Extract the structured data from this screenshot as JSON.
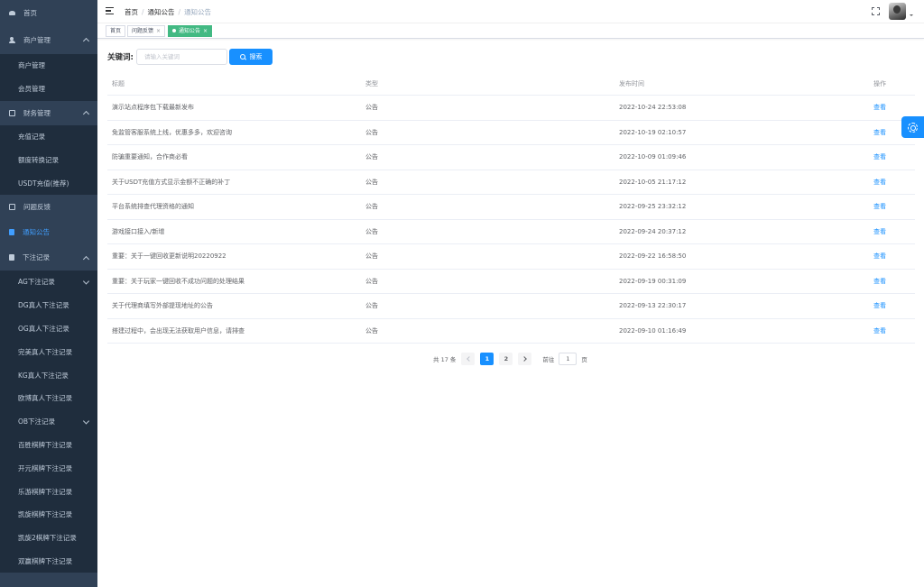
{
  "sidebar": {
    "items": [
      {
        "label": "首页",
        "level": "top",
        "icon": "dashboard-icon"
      },
      {
        "label": "商户管理",
        "level": "top",
        "icon": "user-icon",
        "expanded": true
      },
      {
        "label": "商户管理",
        "level": "sub"
      },
      {
        "label": "会员管理",
        "level": "sub"
      },
      {
        "label": "财务管理",
        "level": "top",
        "icon": "edit-icon",
        "expanded": true
      },
      {
        "label": "充值记录",
        "level": "sub"
      },
      {
        "label": "额度转换记录",
        "level": "sub"
      },
      {
        "label": "USDT充值(推荐)",
        "level": "sub"
      },
      {
        "label": "问题反馈",
        "level": "top",
        "icon": "edit-icon"
      },
      {
        "label": "通知公告",
        "level": "top",
        "icon": "document-icon",
        "active": true
      },
      {
        "label": "下注记录",
        "level": "top",
        "icon": "document-icon",
        "expanded": true
      },
      {
        "label": "AG下注记录",
        "level": "sub2",
        "has_children": true
      },
      {
        "label": "DG真人下注记录",
        "level": "sub2"
      },
      {
        "label": "OG真人下注记录",
        "level": "sub2"
      },
      {
        "label": "完美真人下注记录",
        "level": "sub2"
      },
      {
        "label": "KG真人下注记录",
        "level": "sub2"
      },
      {
        "label": "欧博真人下注记录",
        "level": "sub2"
      },
      {
        "label": "OB下注记录",
        "level": "sub2",
        "has_children": true
      },
      {
        "label": "百胜棋牌下注记录",
        "level": "sub2"
      },
      {
        "label": "开元棋牌下注记录",
        "level": "sub2"
      },
      {
        "label": "乐游棋牌下注记录",
        "level": "sub2"
      },
      {
        "label": "凯旋棋牌下注记录",
        "level": "sub2"
      },
      {
        "label": "凯旋2棋牌下注记录",
        "level": "sub2"
      },
      {
        "label": "双赢棋牌下注记录",
        "level": "sub2"
      }
    ]
  },
  "header": {
    "breadcrumb": [
      "首页",
      "通知公告",
      "通知公告"
    ]
  },
  "tags": [
    {
      "label": "首页",
      "active": false,
      "closable": false
    },
    {
      "label": "问题反馈",
      "active": false,
      "closable": true
    },
    {
      "label": "通知公告",
      "active": true,
      "closable": true
    }
  ],
  "search": {
    "label": "关键词:",
    "placeholder": "请输入关键词",
    "button_label": "搜索"
  },
  "table": {
    "columns": [
      "标题",
      "类型",
      "发布时间",
      "操作"
    ],
    "rows": [
      {
        "title": "演示站点程序包下载最新发布",
        "type": "公告",
        "time": "2022-10-24 22:53:08",
        "action": "查看"
      },
      {
        "title": "免监管客服系统上线，优惠多多，欢迎咨询",
        "type": "公告",
        "time": "2022-10-19 02:10:57",
        "action": "查看"
      },
      {
        "title": "防骗重要通知，合作商必看",
        "type": "公告",
        "time": "2022-10-09 01:09:46",
        "action": "查看"
      },
      {
        "title": "关于USDT充值方式显示金额不正确的补丁",
        "type": "公告",
        "time": "2022-10-05 21:17:12",
        "action": "查看"
      },
      {
        "title": "平台系统排查代理资格的通知",
        "type": "公告",
        "time": "2022-09-25 23:32:12",
        "action": "查看"
      },
      {
        "title": "游戏接口接入/新增",
        "type": "公告",
        "time": "2022-09-24 20:37:12",
        "action": "查看"
      },
      {
        "title": "重要：关于一键回收更新说明20220922",
        "type": "公告",
        "time": "2022-09-22 16:58:50",
        "action": "查看"
      },
      {
        "title": "重要：关于玩家一键回收不成功问题的处理结果",
        "type": "公告",
        "time": "2022-09-19 00:31:09",
        "action": "查看"
      },
      {
        "title": "关于代理商填写外部提现地址的公告",
        "type": "公告",
        "time": "2022-09-13 22:30:17",
        "action": "查看"
      },
      {
        "title": "搭建过程中，会出现无法获取用户信息，请排查",
        "type": "公告",
        "time": "2022-09-10 01:16:49",
        "action": "查看"
      }
    ]
  },
  "pagination": {
    "total_text": "共 17 条",
    "pages": [
      "1",
      "2"
    ],
    "current": "1",
    "goto_label": "前往",
    "goto_value": "1",
    "page_unit": "页"
  },
  "colors": {
    "sidebar_bg": "#304156",
    "submenu_bg": "#1f2d3d",
    "primary": "#1890ff",
    "active_tag": "#42b983"
  }
}
